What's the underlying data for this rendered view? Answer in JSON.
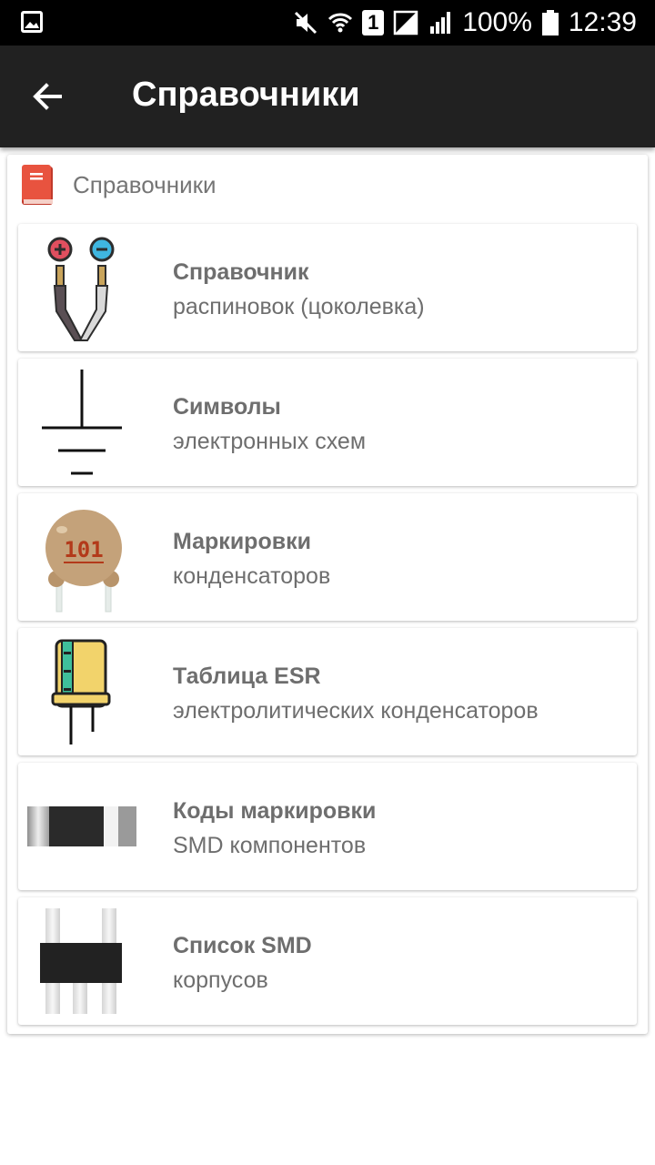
{
  "status_bar": {
    "sim_label": "1",
    "battery": "100%",
    "time": "12:39",
    "icons": [
      "gallery-icon",
      "mute-icon",
      "wifi-icon",
      "sim-icon",
      "no-signal-icon",
      "signal-icon",
      "battery-icon"
    ]
  },
  "app_bar": {
    "title": "Справочники",
    "back_icon": "arrow-left-icon"
  },
  "section": {
    "title": "Справочники",
    "icon": "book-icon"
  },
  "items": [
    {
      "title": "Справочник",
      "subtitle": "распиновок (цоколевка)",
      "icon": "probe-leads-icon"
    },
    {
      "title": "Символы",
      "subtitle": "электронных схем",
      "icon": "ground-symbol-icon"
    },
    {
      "title": "Маркировки",
      "subtitle": "конденсаторов",
      "icon": "ceramic-capacitor-icon",
      "icon_text": "101"
    },
    {
      "title": "Таблица ESR",
      "subtitle": "электролитических конденсаторов",
      "icon": "electrolytic-capacitor-icon"
    },
    {
      "title": "Коды маркировки",
      "subtitle": "SMD компонентов",
      "icon": "smd-resistor-icon"
    },
    {
      "title": "Список SMD",
      "subtitle": "корпусов",
      "icon": "smd-package-icon"
    }
  ],
  "colors": {
    "status_bar": "#000000",
    "app_bar": "#212121",
    "text_gray": "#6e6e6e",
    "book_red": "#e8533f",
    "capacitor_tan": "#c4a27a",
    "capacitor_label": "#b33a1a",
    "electrolytic_yellow": "#f2d36b",
    "electrolytic_stripe": "#3fbf9b"
  }
}
